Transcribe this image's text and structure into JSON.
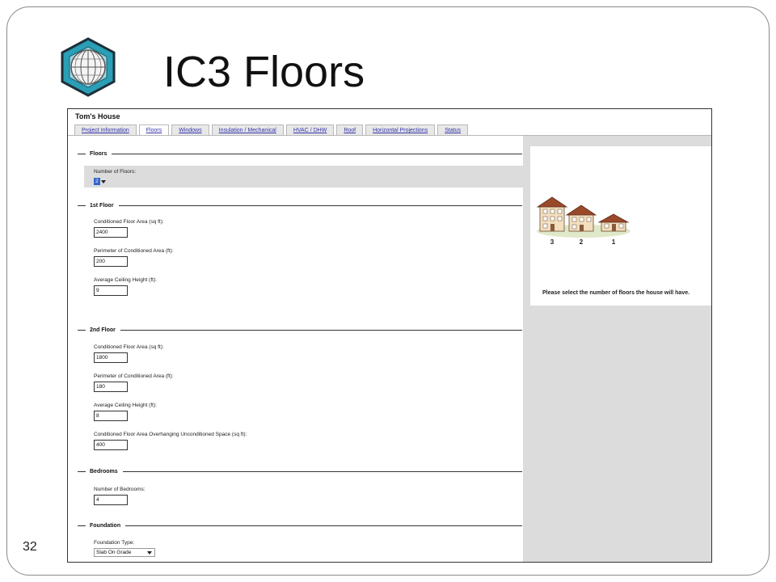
{
  "slide": {
    "title": "IC3 Floors",
    "number": "32"
  },
  "app": {
    "project_title": "Tom's House",
    "tabs": [
      {
        "label": "Project Information"
      },
      {
        "label": "Floors",
        "active": true
      },
      {
        "label": "Windows"
      },
      {
        "label": "Insulation / Mechanical"
      },
      {
        "label": "HVAC / DHW"
      },
      {
        "label": "Roof"
      },
      {
        "label": "Horizontal Projections"
      },
      {
        "label": "Status"
      }
    ],
    "sections": {
      "floors": {
        "heading": "Floors",
        "num_floors_label": "Number of Floors:",
        "num_floors_value": "2"
      },
      "first_floor": {
        "heading": "1st Floor",
        "area_label": "Conditioned Floor Area (sq ft):",
        "area_value": "2400",
        "perimeter_label": "Perimeter of Conditioned Area (ft):",
        "perimeter_value": "200",
        "ceiling_label": "Average Ceiling Height (ft):",
        "ceiling_value": "9"
      },
      "second_floor": {
        "heading": "2nd Floor",
        "area_label": "Conditioned Floor Area (sq ft):",
        "area_value": "1800",
        "perimeter_label": "Perimeter of Conditioned Area (ft):",
        "perimeter_value": "180",
        "ceiling_label": "Average Ceiling Height (ft):",
        "ceiling_value": "8",
        "overhang_label": "Conditioned Floor Area Overhanging Unconditioned Space (sq ft):",
        "overhang_value": "400"
      },
      "bedrooms": {
        "heading": "Bedrooms",
        "count_label": "Number of Bedrooms:",
        "count_value": "4"
      },
      "foundation": {
        "heading": "Foundation",
        "type_label": "Foundation Type:",
        "type_value": "Slab On Grade"
      }
    },
    "help": {
      "house_labels": [
        "3",
        "2",
        "1"
      ],
      "text": "Please select the number of floors the house will have."
    }
  },
  "colors": {
    "tab_link": "#3333aa",
    "panel_gray": "#dcdcdc",
    "logo_teal": "#2a9fb5"
  }
}
